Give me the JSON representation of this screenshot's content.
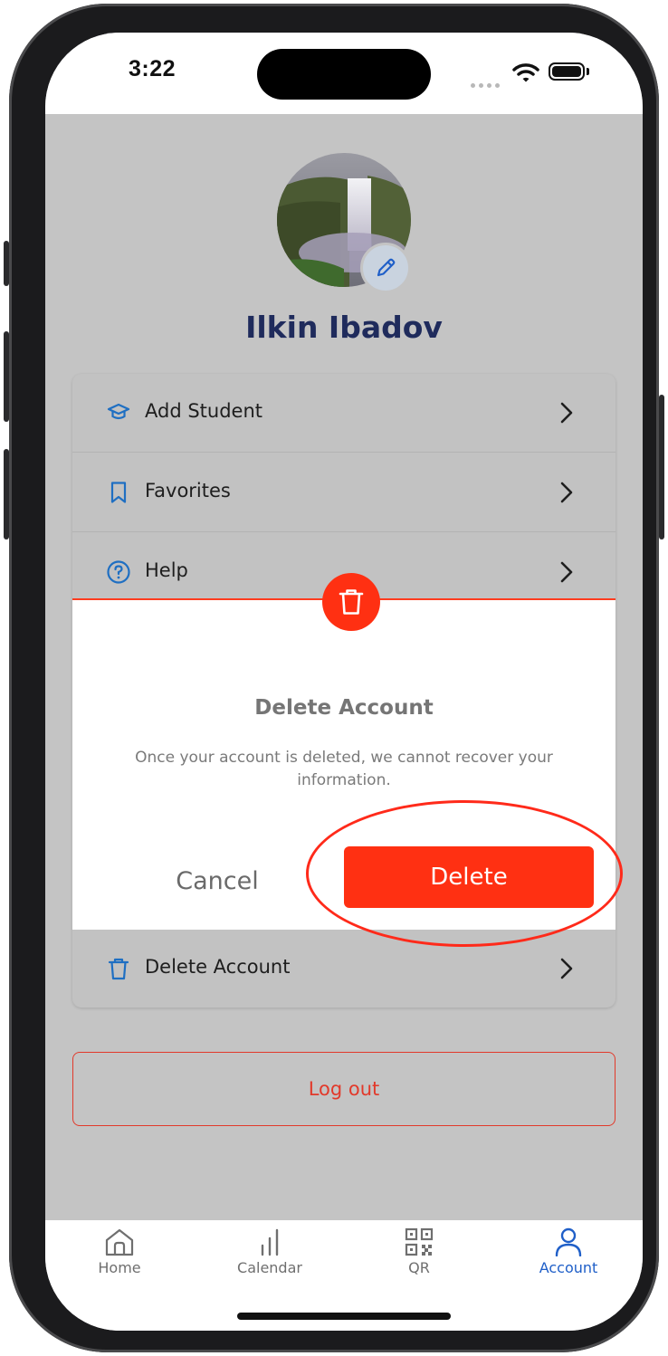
{
  "status_bar": {
    "time": "3:22"
  },
  "profile": {
    "name": "Ilkin Ibadov",
    "avatar_icon": "waterfall-photo",
    "edit_icon": "pencil-icon"
  },
  "menu": {
    "items": [
      {
        "label": "Add Student",
        "icon": "graduation-cap-icon"
      },
      {
        "label": "Favorites",
        "icon": "bookmark-icon"
      },
      {
        "label": "Help",
        "icon": "help-circle-icon"
      },
      {
        "label": "Delete Account",
        "icon": "trash-icon"
      }
    ]
  },
  "modal": {
    "title": "Delete Account",
    "message": "Once your account is deleted, we cannot recover your information.",
    "cancel_label": "Cancel",
    "delete_label": "Delete",
    "badge_icon": "trash-icon"
  },
  "logout": {
    "label": "Log out"
  },
  "tab_bar": {
    "tabs": [
      {
        "label": "Home",
        "icon": "home-icon"
      },
      {
        "label": "Calendar",
        "icon": "bar-chart-icon"
      },
      {
        "label": "QR",
        "icon": "qr-code-icon"
      },
      {
        "label": "Account",
        "icon": "user-icon",
        "active": true
      }
    ]
  },
  "colors": {
    "accent_blue": "#1f5fc8",
    "danger_red": "#ff3012",
    "name_navy": "#1f2b5c",
    "overlay_gray": "#c4c4c4"
  }
}
